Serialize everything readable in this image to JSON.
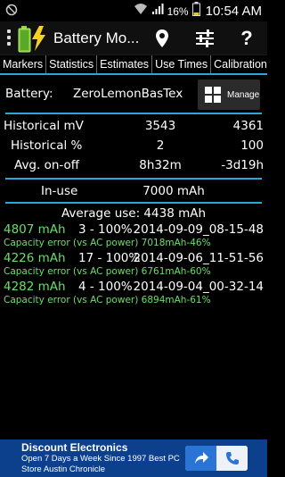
{
  "status_bar": {
    "battery_percent": "16%",
    "time": "10:54 AM"
  },
  "action_bar": {
    "title": "Battery Mo...",
    "icons": [
      "overflow-menu-icon",
      "battery-charging-icon",
      "location-pin-icon",
      "settings-sliders-icon",
      "help-icon"
    ],
    "help_label": "?"
  },
  "tabs": [
    "Markers",
    "Statistics",
    "Estimates",
    "Use Times",
    "Calibration"
  ],
  "battery": {
    "label": "Battery:",
    "name": "ZeroLemonBasTex",
    "manage_label": "Manage"
  },
  "stats": {
    "historical_mv": {
      "label": "Historical mV",
      "value1": "3543",
      "value2": "4361"
    },
    "historical_pct": {
      "label": "Historical %",
      "value1": "2",
      "value2": "100"
    },
    "avg_on_off": {
      "label": "Avg. on-off",
      "value1": "8h32m",
      "value2": "-3d19h"
    }
  },
  "in_use": {
    "label": "In-use",
    "value": "7000 mAh"
  },
  "average_use": "Average use: 4438 mAh",
  "entries": [
    {
      "capacity": "4807 mAh",
      "range": "3 - 100%",
      "date": "2014-09-09_08-15-48",
      "error": "Capacity error (vs AC power) 7018mAh-46%"
    },
    {
      "capacity": "4226 mAh",
      "range": "17 - 100%",
      "date": "2014-09-06_11-51-56",
      "error": "Capacity error (vs AC power) 6761mAh-60%"
    },
    {
      "capacity": "4282 mAh",
      "range": "4 - 100%",
      "date": "2014-09-04_00-32-14",
      "error": "Capacity error (vs AC power) 6894mAh-61%"
    }
  ],
  "ad": {
    "title": "Discount Electronics",
    "text": "Open 7 Days a Week Since 1997 Best PC Store Austin Chronicle"
  },
  "colors": {
    "accent": "#2aa7d9",
    "capacity_green": "#66e066",
    "ad_background": "#0c3f8c"
  }
}
